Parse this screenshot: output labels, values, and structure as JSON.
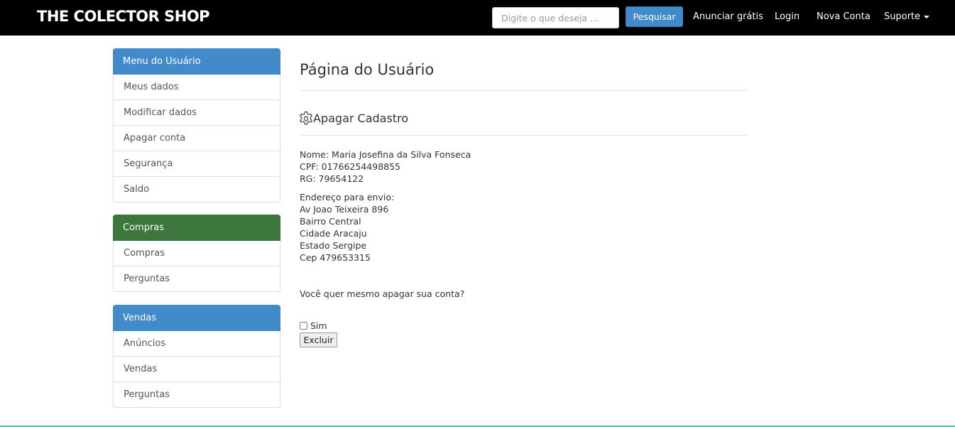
{
  "header": {
    "brand": "THE COLECTOR SHOP",
    "search": {
      "placeholder": "Digite o que deseja ...",
      "value": ""
    },
    "search_button": "Pesquisar",
    "links": {
      "advertise": "Anunciar grátis",
      "login": "Login",
      "new_account": "Nova Conta",
      "support": "Suporte"
    }
  },
  "sidebar": {
    "user_menu": {
      "title": "Menu do Usuário",
      "color": "#428bca",
      "items": [
        "Meus dados",
        "Modificar dados",
        "Apagar conta",
        "Segurança",
        "Saldo"
      ]
    },
    "purchases": {
      "title": "Compras",
      "color": "#3c763d",
      "items": [
        "Compras",
        "Perguntas"
      ]
    },
    "sales": {
      "title": "Vendas",
      "color": "#428bca",
      "items": [
        "Anúncios",
        "Vendas",
        "Perguntas"
      ]
    }
  },
  "main": {
    "page_title": "Página do Usuário",
    "section_icon": "gear-icon",
    "section_title": "Apagar Cadastro",
    "personal": {
      "name": "Nome: Maria Josefina da Silva Fonseca",
      "cpf": "CPF: 01766254498855",
      "rg": "RG: 79654122"
    },
    "address": {
      "label": "Endereço para envio:",
      "street": "Av Joao Teixeira 896",
      "district": "Bairro Central",
      "city": "Cidade Aracaju",
      "state": "Estado Sergipe",
      "zip": "Cep 479653315"
    },
    "confirm_question": "Você quer mesmo apagar sua conta?",
    "confirm_checkbox_label": "Sim",
    "delete_button": "Excluir"
  }
}
